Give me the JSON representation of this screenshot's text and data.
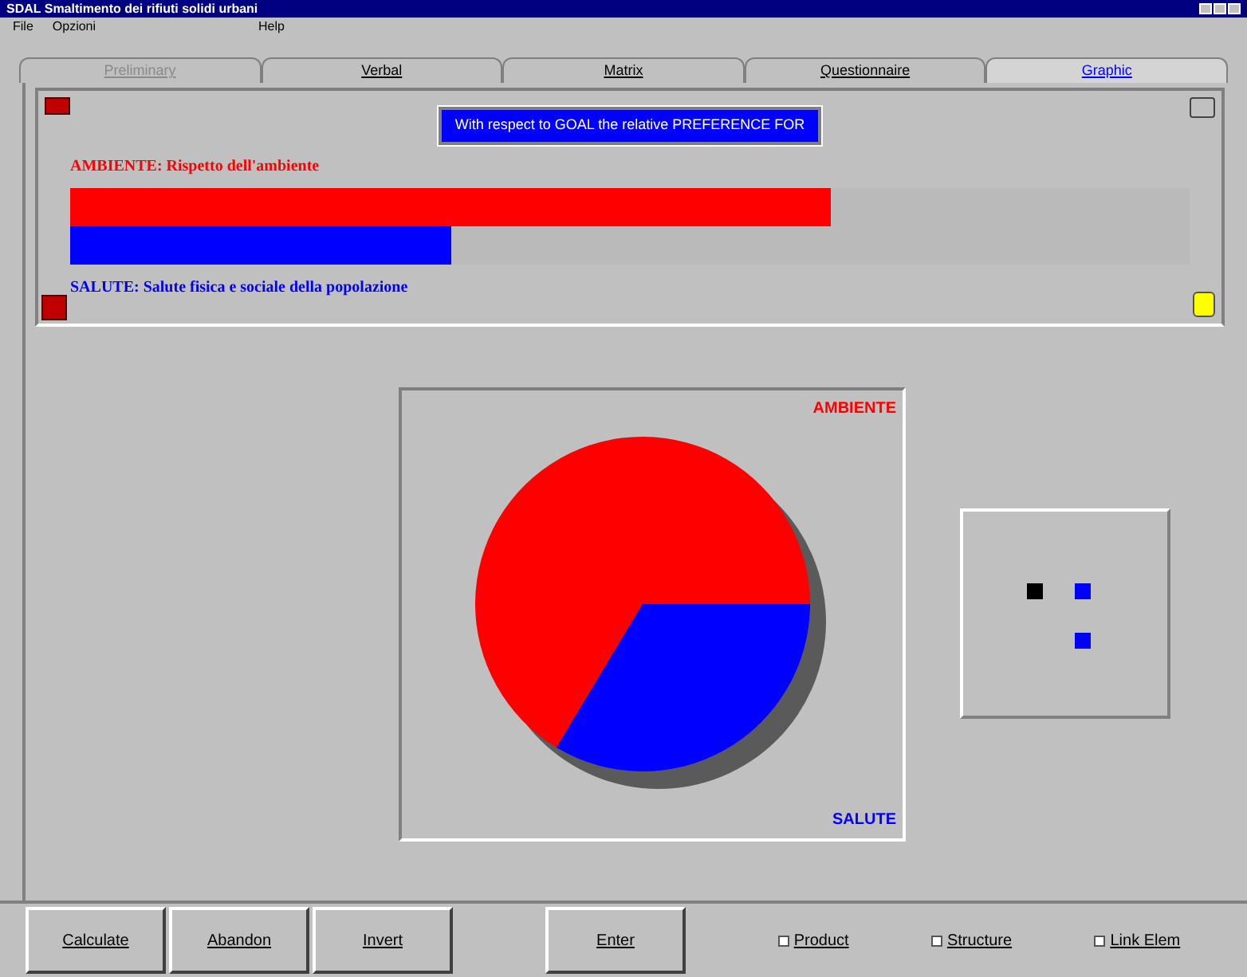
{
  "window": {
    "title": "SDAL  Smaltimento dei rifiuti solidi urbani"
  },
  "menu": [
    "File",
    "Opzioni",
    "Help"
  ],
  "tabs": [
    {
      "label": "Preliminary",
      "selected": false,
      "disabled": true
    },
    {
      "label": "Verbal",
      "selected": false,
      "disabled": false
    },
    {
      "label": "Matrix",
      "selected": false,
      "disabled": false
    },
    {
      "label": "Questionnaire",
      "selected": false,
      "disabled": false
    },
    {
      "label": "Graphic",
      "selected": true,
      "disabled": false
    }
  ],
  "comparison": {
    "banner": "With respect to GOAL the relative PREFERENCE FOR",
    "items": [
      {
        "label": "AMBIENTE: Rispetto dell'ambiente",
        "color": "#ff0000",
        "level": 0.68
      },
      {
        "label": "SALUTE: Salute fisica e sociale della popolazione",
        "color": "#0000ff",
        "level": 0.34
      }
    ]
  },
  "pie": {
    "chart_data": {
      "type": "pie",
      "categories": [
        "AMBIENTE",
        "SALUTE"
      ],
      "values": [
        0.664,
        0.336
      ],
      "colors": [
        "#ff0000",
        "#0000ff"
      ]
    }
  },
  "buttons": [
    "Calculate",
    "Abandon",
    "Invert",
    "Enter"
  ],
  "options": [
    {
      "label": "Product",
      "checked": false
    },
    {
      "label": "Structure",
      "checked": false
    },
    {
      "label": "Link Elem",
      "checked": false
    }
  ]
}
